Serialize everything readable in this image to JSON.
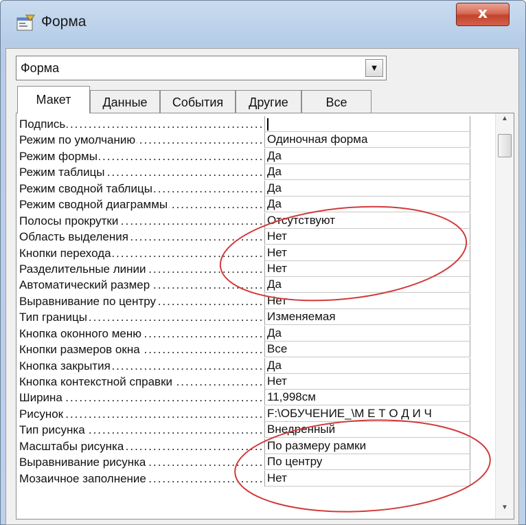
{
  "window": {
    "title": "Форма",
    "close_symbol": "x",
    "icon": "form-properties-icon"
  },
  "selector": {
    "value": "Форма",
    "arrow_icon": "dropdown-arrow-icon"
  },
  "tabs": [
    {
      "label": "Макет",
      "active": true
    },
    {
      "label": "Данные",
      "active": false
    },
    {
      "label": "События",
      "active": false
    },
    {
      "label": "Другие",
      "active": false
    },
    {
      "label": "Все",
      "active": false
    }
  ],
  "properties": [
    {
      "name": "Подпись",
      "value": ""
    },
    {
      "name": "Режим по умолчанию",
      "value": "Одиночная форма"
    },
    {
      "name": "Режим формы",
      "value": "Да"
    },
    {
      "name": "Режим таблицы",
      "value": "Да"
    },
    {
      "name": "Режим сводной таблицы",
      "value": "Да"
    },
    {
      "name": "Режим сводной диаграммы",
      "value": "Да"
    },
    {
      "name": "Полосы прокрутки",
      "value": "Отсутствуют"
    },
    {
      "name": "Область выделения",
      "value": "Нет"
    },
    {
      "name": "Кнопки перехода",
      "value": "Нет"
    },
    {
      "name": "Разделительные линии",
      "value": "Нет"
    },
    {
      "name": "Автоматический размер",
      "value": "Да"
    },
    {
      "name": "Выравнивание по центру",
      "value": "Нет"
    },
    {
      "name": "Тип границы",
      "value": "Изменяемая"
    },
    {
      "name": "Кнопка оконного меню",
      "value": "Да"
    },
    {
      "name": "Кнопки размеров окна",
      "value": "Все"
    },
    {
      "name": "Кнопка закрытия",
      "value": "Да"
    },
    {
      "name": "Кнопка контекстной справки",
      "value": "Нет"
    },
    {
      "name": "Ширина",
      "value": "11,998см"
    },
    {
      "name": "Рисунок",
      "value": "F:\\ОБУЧЕНИЕ_\\М Е Т О Д И Ч"
    },
    {
      "name": "Тип рисунка",
      "value": "Внедренный"
    },
    {
      "name": "Масштабы рисунка",
      "value": "По размеру рамки"
    },
    {
      "name": "Выравнивание рисунка",
      "value": "По центру"
    },
    {
      "name": "Мозаичное заполнение",
      "value": "Нет"
    }
  ],
  "colors": {
    "annotation": "#d23a3a",
    "close_button": "#c9442e",
    "titlebar": "#bcd1ea"
  }
}
